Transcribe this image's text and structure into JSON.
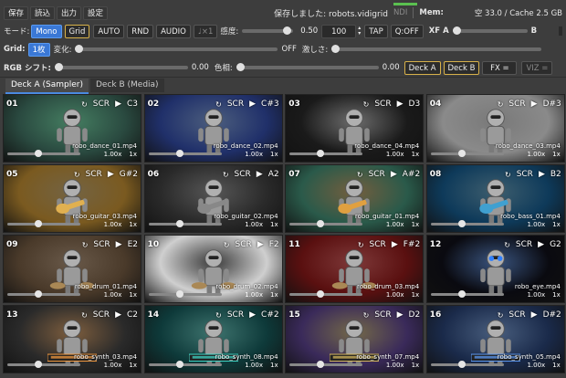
{
  "menu": {
    "save": "保存",
    "load": "読込",
    "output": "出力",
    "settings": "設定"
  },
  "status": {
    "saved_text": "保存しました: robots.vidigrid",
    "ndi": "NDI",
    "mem_label": "Mem:",
    "cache": "空 33.0 / Cache 2.5 GB"
  },
  "row2": {
    "mode_label": "モード:",
    "mono": "Mono",
    "grid": "Grid",
    "auto": "AUTO",
    "rnd": "RND",
    "audio": "AUDIO",
    "note": "♩×1",
    "sense_label": "感度:",
    "sense_val": "0.50",
    "sense_level": 0.88,
    "bpm": "100",
    "tap": "TAP",
    "qoff": "Q:OFF",
    "xfa": "XF A",
    "xfb": "B",
    "xf_pos": 0.0
  },
  "row3": {
    "grid_label": "Grid:",
    "grid_sel": "1枚",
    "change_label": "変化:",
    "off": "OFF",
    "intense_label": "激しさ:",
    "intense_val": 0.0
  },
  "row4": {
    "rgb_label": "RGB シフト:",
    "rgb_val": "0.00",
    "hue_label": "色相:",
    "hue_val": "0.00",
    "deck_a": "Deck A",
    "deck_b": "Deck B",
    "fx": "FX =",
    "viz": "VIZ ="
  },
  "tabs": [
    {
      "label": "Deck A (Sampler)"
    },
    {
      "label": "Deck B (Media)"
    }
  ],
  "grid": [
    {
      "id": "01",
      "scr": "SCR",
      "note": "C3",
      "file": "robo_dance_01.mp4",
      "speed": "1.00x",
      "mult": "1x",
      "bg": "#2a4a40",
      "accent": "#55ffaa",
      "theme": "dance"
    },
    {
      "id": "02",
      "scr": "SCR",
      "note": "C#3",
      "file": "robo_dance_02.mp4",
      "speed": "1.00x",
      "mult": "1x",
      "bg": "#20306a",
      "accent": "#6aa0ff",
      "theme": "dance"
    },
    {
      "id": "03",
      "scr": "SCR",
      "note": "D3",
      "file": "robo_dance_04.mp4",
      "speed": "1.00x",
      "mult": "1x",
      "bg": "#1a1a1a",
      "accent": "#cccccc",
      "theme": "dance"
    },
    {
      "id": "04",
      "scr": "SCR",
      "note": "D#3",
      "file": "robo_dance_03.mp4",
      "speed": "1.00x",
      "mult": "1x",
      "bg": "#8a8a8a",
      "accent": "#f0f0f0",
      "theme": "dance"
    },
    {
      "id": "05",
      "scr": "SCR",
      "note": "G#2",
      "file": "robo_guitar_03.mp4",
      "speed": "1.00x",
      "mult": "1x",
      "bg": "#7a5a20",
      "accent": "#e0b050",
      "theme": "guitar"
    },
    {
      "id": "06",
      "scr": "SCR",
      "note": "A2",
      "file": "robo_guitar_02.mp4",
      "speed": "1.00x",
      "mult": "1x",
      "bg": "#2a2a2a",
      "accent": "#888888",
      "theme": "guitar"
    },
    {
      "id": "07",
      "scr": "SCR",
      "note": "A#2",
      "file": "robo_guitar_01.mp4",
      "speed": "1.00x",
      "mult": "1x",
      "bg": "#2a5a4a",
      "accent": "#e0a040",
      "theme": "guitar"
    },
    {
      "id": "08",
      "scr": "SCR",
      "note": "B2",
      "file": "robo_bass_01.mp4",
      "speed": "1.00x",
      "mult": "1x",
      "bg": "#0e3a5a",
      "accent": "#40a0d0",
      "theme": "guitar"
    },
    {
      "id": "09",
      "scr": "SCR",
      "note": "E2",
      "file": "robo_drum_01.mp4",
      "speed": "1.00x",
      "mult": "1x",
      "bg": "#4a3a2a",
      "accent": "#c09060",
      "theme": "drum"
    },
    {
      "id": "10",
      "scr": "SCR",
      "note": "F2",
      "file": "robo_drum_02.mp4",
      "speed": "1.00x",
      "mult": "1x",
      "bg": "#cfcfcf",
      "accent": "#333333",
      "theme": "drum"
    },
    {
      "id": "11",
      "scr": "SCR",
      "note": "F#2",
      "file": "robo_drum_03.mp4",
      "speed": "1.00x",
      "mult": "1x",
      "bg": "#5a1010",
      "accent": "#ff3030",
      "theme": "drum"
    },
    {
      "id": "12",
      "scr": "SCR",
      "note": "G2",
      "file": "robo_eye.mp4",
      "speed": "1.00x",
      "mult": "1x",
      "bg": "#0a0a10",
      "accent": "#3080ff",
      "theme": "eye"
    },
    {
      "id": "13",
      "scr": "SCR",
      "note": "C2",
      "file": "robo_synth_03.mp4",
      "speed": "1.00x",
      "mult": "1x",
      "bg": "#2a2a2a",
      "accent": "#ffa040",
      "theme": "synth"
    },
    {
      "id": "14",
      "scr": "SCR",
      "note": "C#2",
      "file": "robo_synth_08.mp4",
      "speed": "1.00x",
      "mult": "1x",
      "bg": "#0e3a3a",
      "accent": "#40e0d0",
      "theme": "synth"
    },
    {
      "id": "15",
      "scr": "SCR",
      "note": "D2",
      "file": "robo_synth_07.mp4",
      "speed": "1.00x",
      "mult": "1x",
      "bg": "#3a2a5a",
      "accent": "#e0c060",
      "theme": "synth"
    },
    {
      "id": "16",
      "scr": "SCR",
      "note": "D#2",
      "file": "robo_synth_05.mp4",
      "speed": "1.00x",
      "mult": "1x",
      "bg": "#1a2a4a",
      "accent": "#60a0ff",
      "theme": "synth"
    }
  ]
}
